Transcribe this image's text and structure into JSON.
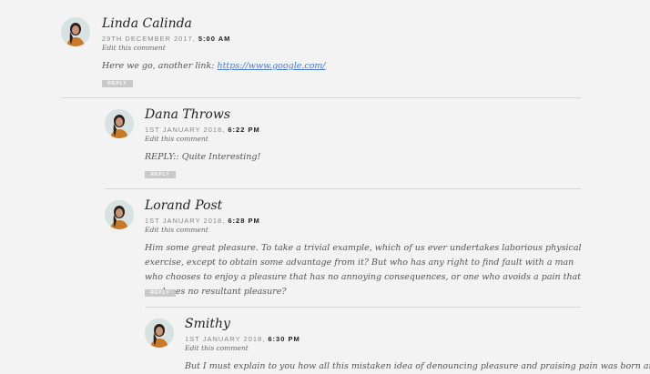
{
  "comments": [
    {
      "author": "Linda Calinda",
      "date": "29TH DECEMBER 2017,",
      "time": "5:00 AM",
      "edit_label": "Edit this comment",
      "text_prefix": "Here we go, another link: ",
      "link_text": "https://www.google.com/",
      "reply_label": "REPLY"
    },
    {
      "author": "Dana Throws",
      "date": "1ST JANUARY 2018,",
      "time": "6:22 PM",
      "edit_label": "Edit this comment",
      "text": "REPLY:: Quite Interesting!",
      "reply_label": "REPLY"
    },
    {
      "author": "Lorand Post",
      "date": "1ST JANUARY 2018,",
      "time": "6:28 PM",
      "edit_label": "Edit this comment",
      "text": "Him some great pleasure. To take a trivial example, which of us ever undertakes laborious physical exercise, except to obtain some advantage from it? But who has any right to find fault with a man who chooses to enjoy a pleasure that has no annoying consequences, or one who avoids a pain that produces no resultant pleasure?",
      "reply_label": "REPLY"
    },
    {
      "author": "Smithy",
      "date": "1ST JANUARY 2018,",
      "time": "6:30 PM",
      "edit_label": "Edit this comment",
      "text": "But I must explain to you how all this mistaken idea of denouncing pleasure and praising pain was born and"
    }
  ],
  "colors": {
    "background": "#f3f3f3",
    "link": "#4a79c8",
    "reply_button": "#c9c9c9",
    "divider": "#d6d6d6"
  }
}
